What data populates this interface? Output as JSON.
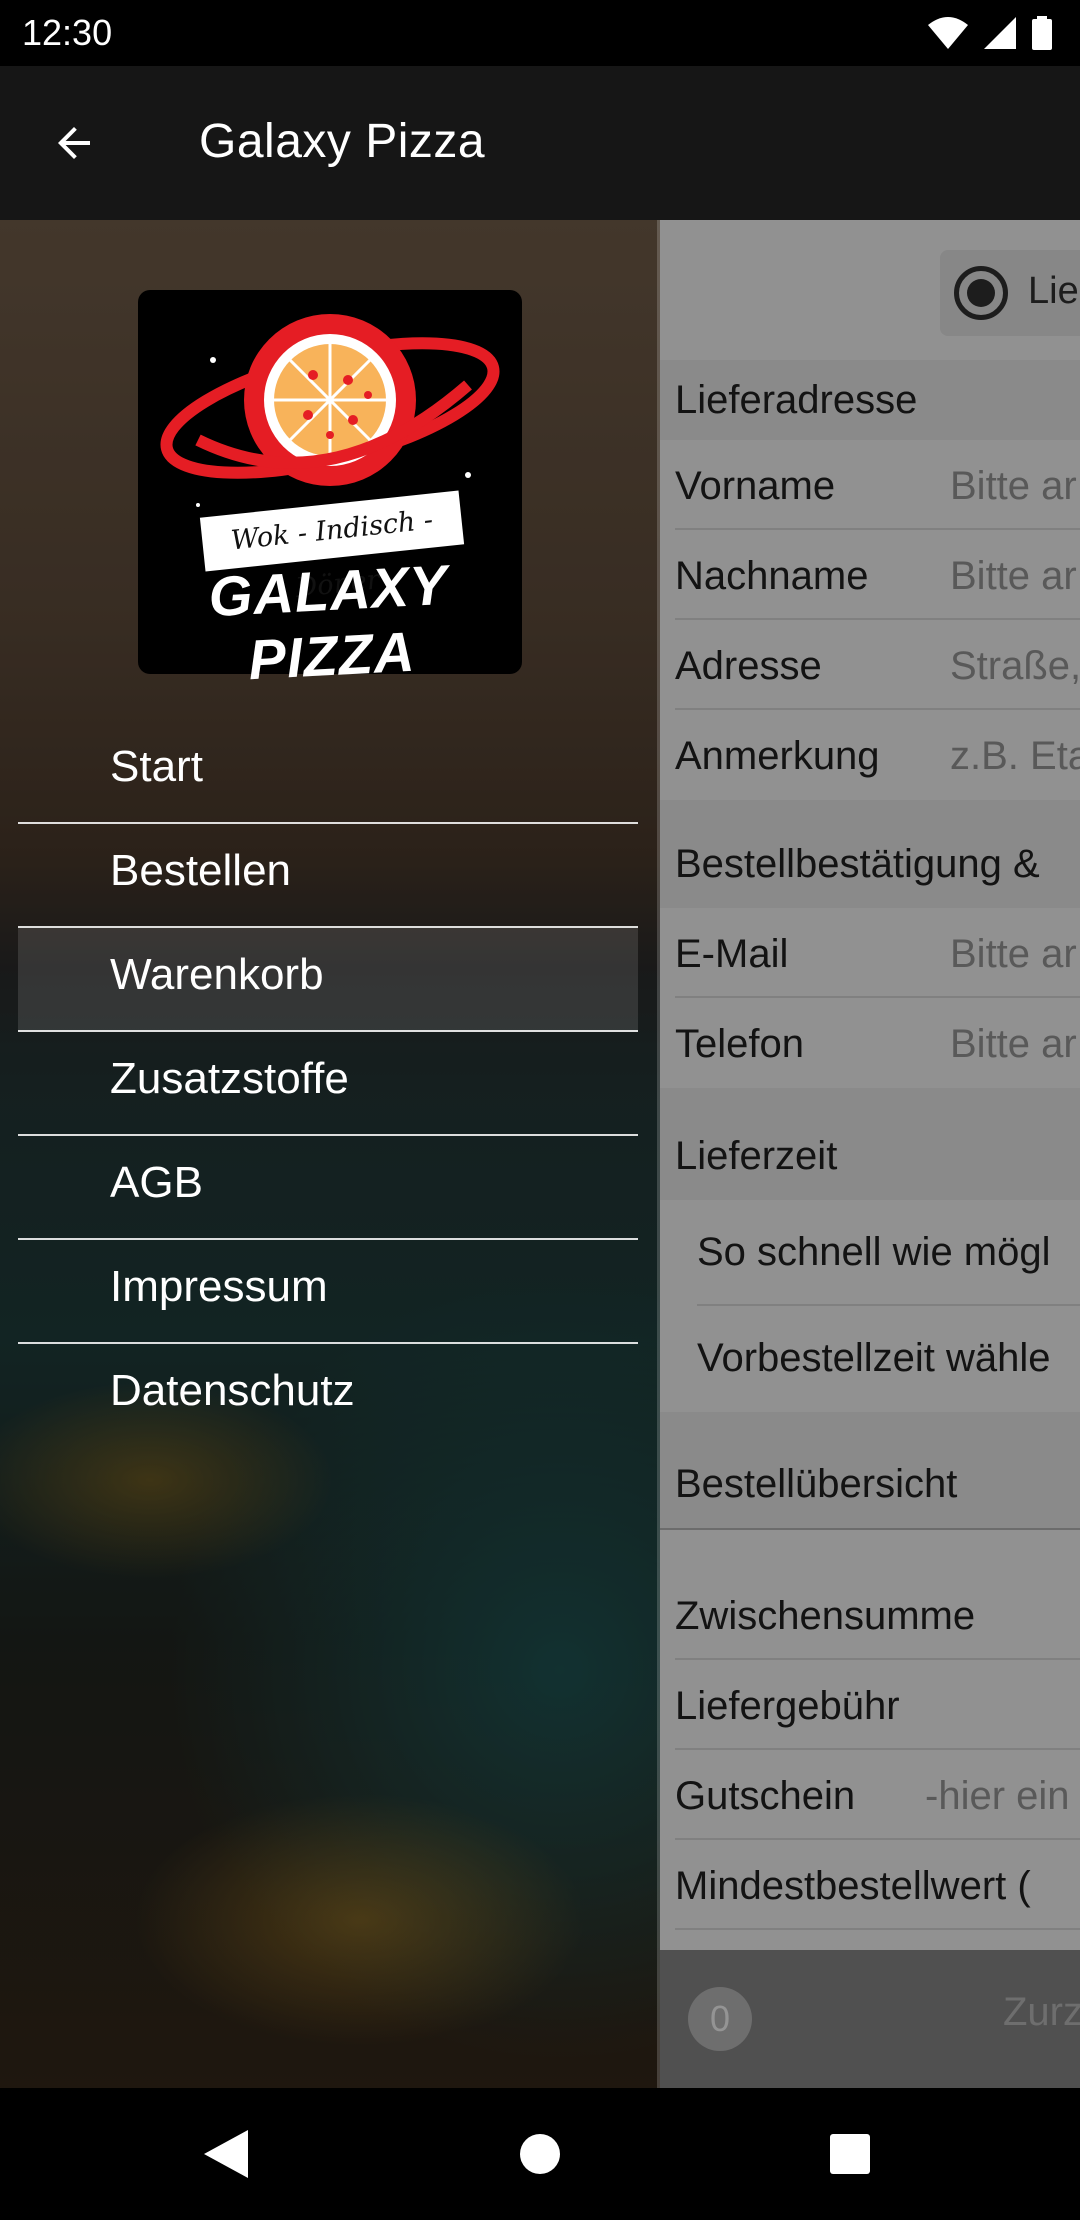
{
  "status_bar": {
    "time": "12:30",
    "icons": [
      "wifi-icon",
      "signal-icon",
      "battery-icon"
    ]
  },
  "app_bar": {
    "title": "Galaxy Pizza",
    "back_icon": "arrow-back-icon"
  },
  "drawer": {
    "logo": {
      "subtitle": "Wok - Indisch - Döner",
      "name": "GALAXY PIZZA"
    },
    "menu": [
      {
        "label": "Start"
      },
      {
        "label": "Bestellen"
      },
      {
        "label": "Warenkorb",
        "active": true
      },
      {
        "label": "Zusatzstoffe"
      },
      {
        "label": "AGB"
      },
      {
        "label": "Impressum"
      },
      {
        "label": "Datenschutz"
      }
    ]
  },
  "main": {
    "delivery_option": "Lie",
    "sections": {
      "address": "Lieferadresse",
      "confirmation": "Bestellbestätigung &",
      "delivery_time": "Lieferzeit",
      "summary": "Bestellübersicht"
    },
    "fields": {
      "firstname": {
        "label": "Vorname",
        "placeholder": "Bitte ar"
      },
      "lastname": {
        "label": "Nachname",
        "placeholder": "Bitte ar"
      },
      "address": {
        "label": "Adresse",
        "placeholder": "Straße,"
      },
      "note": {
        "label": "Anmerkung",
        "placeholder": "z.B. Eta"
      },
      "email": {
        "label": "E-Mail",
        "placeholder": "Bitte ar"
      },
      "phone": {
        "label": "Telefon",
        "placeholder": "Bitte ar"
      },
      "voucher": {
        "label": "Gutschein",
        "placeholder": "-hier ein"
      }
    },
    "delivery_options": {
      "asap": "So schnell wie mögl",
      "preorder": "Vorbestellzeit wähle"
    },
    "summary_rows": {
      "subtotal": "Zwischensumme",
      "delivery_fee": "Liefergebühr",
      "minimum": "Mindestbestellwert ("
    },
    "bottom_bar": {
      "cart_count": "0",
      "label": "Zurz"
    }
  },
  "nav_bar": {
    "icons": [
      "back-triangle-icon",
      "home-circle-icon",
      "recents-square-icon"
    ]
  }
}
